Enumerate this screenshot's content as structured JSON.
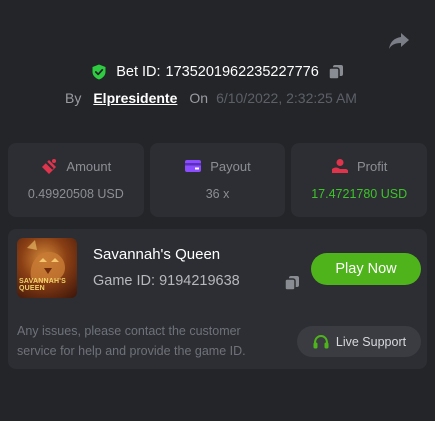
{
  "bet": {
    "label": "Bet ID:",
    "id": "1735201962235227776",
    "by_label": "By",
    "user": "Elpresidente",
    "on_label": "On",
    "date": "6/10/2022, 2:32:25 AM"
  },
  "stats": {
    "amount": {
      "label": "Amount",
      "value": "0.49920508 USD"
    },
    "payout": {
      "label": "Payout",
      "value": "36 x"
    },
    "profit": {
      "label": "Profit",
      "value": "17.4721780 USD"
    }
  },
  "game": {
    "name": "Savannah's Queen",
    "id_text": "Game ID: 9194219638",
    "thumb_text": "SAVANNAH'S QUEEN",
    "play_label": "Play Now"
  },
  "support": {
    "issue_text": "Any issues, please contact the customer service for help and provide the game ID.",
    "button_label": "Live Support"
  },
  "colors": {
    "background": "#232529",
    "card": "#2c2e33",
    "accent_green": "#4fb31b",
    "profit_green": "#3ec42a",
    "amount_red": "#e0344d",
    "payout_purple": "#8b4dff"
  },
  "icons": [
    "share-icon",
    "shield-check-icon",
    "copy-icon",
    "amount-icon",
    "payout-icon",
    "profit-icon",
    "headset-icon"
  ]
}
